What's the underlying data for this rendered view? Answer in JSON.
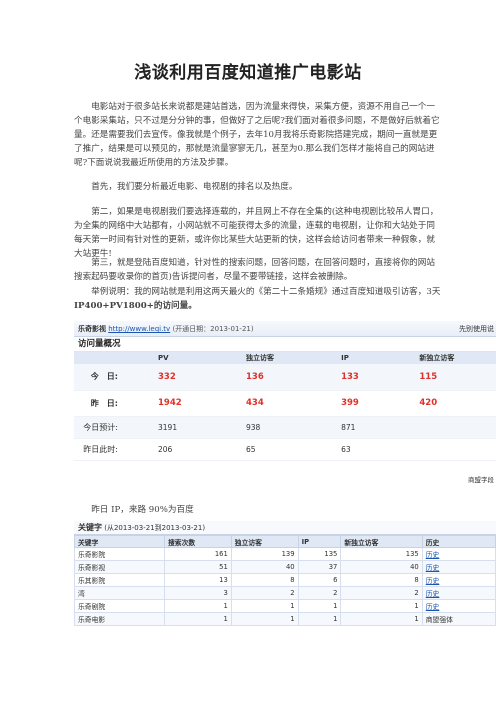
{
  "title": "浅谈利用百度知道推广电影站",
  "paragraphs": [
    [
      "　　电影站对于很多站长来说都是建站首选，因为流量来得快，采集方便，资源不用自己一个一",
      "个电影采集站，只不过是分分钟的事，但做好了之后呢?我们面对着很多问题，不是做好后就着它",
      "量。还是需要我们去宣传。像我就是个例子，去年10月我将乐奇影院搭建完成，期间一直就是更",
      "了推广，结果是可以预见的，那就是流量寥寥无几，甚至为0.那么我们怎样才能将自己的网站进",
      "呢?下面说说我最近所使用的方法及步骤。"
    ],
    [
      "　　首先，我们要分析最近电影、电视剧的排名以及热度。"
    ],
    [
      "　　第二，如果是电视剧我们要选择连载的，并且网上不存在全集的(这种电视剧比较吊人胃口，",
      "为全集的网络中大站都有，小网站就不可能获得太多的流量，连载的电视剧，让你和大站处于同",
      "每天第一时间有针对性的更新，或许你比某些大站更新的快，这样会给访问者带来一种假象，就",
      "大站更牛!"
    ],
    [
      "　　第三，就是登陆百度知道，针对性的搜索问题，回答问题，在回答问题时，直接将你的网站",
      "搜索起码要收录你的首页)告诉提问者，尽量不要带链接，这样会被删除。"
    ],
    [
      "　　举例说明：我的网站就是利用这两天最火的《第二十二条婚规》通过百度知道吸引访客，3天",
      "IP400+PV1800+的访问量。"
    ]
  ],
  "stats_panel": {
    "site_name": "乐奇影视",
    "site_url": "http://www.leqi.tv",
    "site_date": "(开通日期：2013-01-21)",
    "right_link": "先别使用说",
    "section_title": "访问量概况",
    "columns": [
      "",
      "PV",
      "独立访客",
      "IP",
      "新独立访客"
    ],
    "rows": [
      {
        "label": "今　日:",
        "values": [
          "332",
          "136",
          "133",
          "115"
        ]
      },
      {
        "label": "昨　日:",
        "values": [
          "1942",
          "434",
          "399",
          "420"
        ]
      },
      {
        "label": "今日预计:",
        "values": [
          "3191",
          "938",
          "871",
          ""
        ]
      },
      {
        "label": "昨日此时:",
        "values": [
          "206",
          "65",
          "63",
          ""
        ]
      }
    ],
    "footer": "商盟字段"
  },
  "caption": "　　昨日 IP，来路 90%为百度",
  "keyword_panel": {
    "title": "关键字",
    "range": "(从2013-03-21到2013-03-21)",
    "columns": [
      "关键字",
      "搜索次数",
      "独立访客",
      "IP",
      "新独立访客",
      "历史"
    ],
    "rows": [
      [
        "乐奇影院",
        "161",
        "139",
        "135",
        "135",
        "历史"
      ],
      [
        "乐奇影视",
        "51",
        "40",
        "37",
        "40",
        "历史"
      ],
      [
        "乐其影院",
        "13",
        "8",
        "6",
        "8",
        "历史"
      ],
      [
        "湾",
        "3",
        "2",
        "2",
        "2",
        "历史"
      ],
      [
        "乐奇剧院",
        "1",
        "1",
        "1",
        "1",
        "历史"
      ],
      [
        "乐奇电影",
        "1",
        "1",
        "1",
        "1",
        "商盟强体"
      ]
    ]
  },
  "colors": {
    "highlight_red": "#e0302a",
    "link_blue": "#1a55b0",
    "header_bg": "#dfe8f4"
  }
}
